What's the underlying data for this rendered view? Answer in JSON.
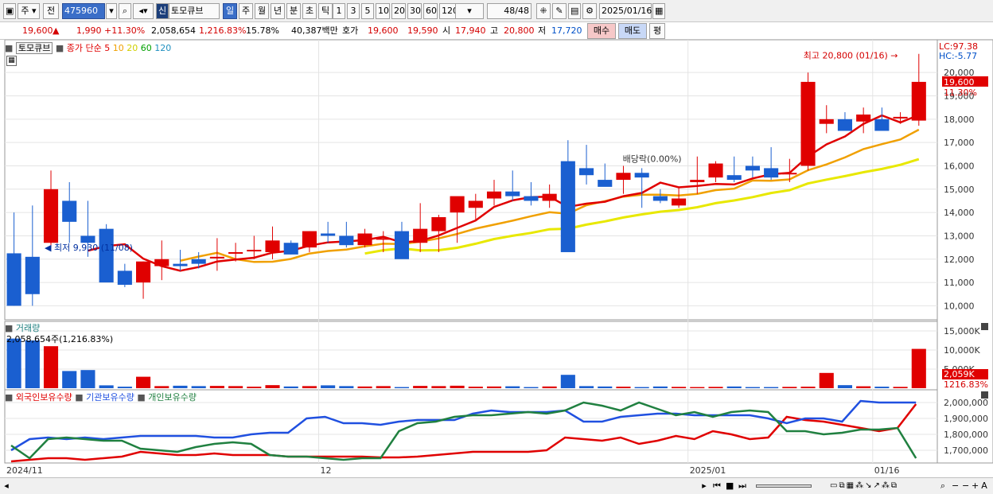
{
  "toolbar": {
    "market": "주",
    "all": "전",
    "code": "475960",
    "credit_badge": "신",
    "stock_name": "토모큐브",
    "periods": [
      "일",
      "주",
      "월",
      "년",
      "분",
      "초",
      "틱"
    ],
    "selected_period": "일",
    "intervals": [
      "1",
      "3",
      "5",
      "10",
      "20",
      "30",
      "60",
      "120"
    ],
    "count": "48",
    "count_total": "/48",
    "date": "2025/01/16"
  },
  "quote": {
    "price": "19,600",
    "arrow": "▲",
    "change": "1,990",
    "change_pct": "+11.30%",
    "volume": "2,058,654",
    "volume_pct": "1,216.83%",
    "turnover": "15.78%",
    "amount": "40,387백만",
    "bid_label": "호가",
    "ask": "19,600",
    "bid": "19,590",
    "open_label": "시",
    "open": "17,940",
    "high_label": "고",
    "high": "20,800",
    "low_label": "저",
    "low": "17,720",
    "buy_btn": "매수",
    "sell_btn": "매도",
    "eval_btn": "평"
  },
  "price_panel": {
    "name_tag": "토모큐브",
    "ma_label": "종가 단순",
    "ma_periods": [
      "5",
      "10",
      "20",
      "60",
      "120"
    ],
    "ma_colors": [
      "#e00000",
      "#f0a000",
      "#e8e800",
      "#00a000",
      "#2090c0"
    ],
    "lc": "LC:97.38",
    "hc": "HC:-5.77",
    "high_annot": "최고 20,800 (01/16)",
    "low_annot": "최저 9,930 (11/08)",
    "dividend_annot": "배당락(0.00%)",
    "last_price_tag": "19,600",
    "last_pct_tag": "11.30%"
  },
  "volume_panel": {
    "title": "거래량",
    "value_label": "2,058,654주(1,216.83%)",
    "last_tag": "2,059K",
    "last_pct_tag": "1216.83%"
  },
  "holding_panel": {
    "series_names": [
      "외국인보유수량",
      "기관보유수량",
      "개인보유수량"
    ],
    "series_colors": [
      "#e00000",
      "#2050e0",
      "#208040"
    ]
  },
  "x_axis": {
    "labels": [
      {
        "text": "2024/11",
        "index": 0
      },
      {
        "text": "12",
        "index": 17
      },
      {
        "text": "2025/01",
        "index": 37
      },
      {
        "text": "01/16",
        "index": 47
      }
    ]
  },
  "chart_data": [
    {
      "type": "candlestick",
      "x": [
        "11/05",
        "11/06",
        "11/07",
        "11/08",
        "11/11",
        "11/12",
        "11/13",
        "11/14",
        "11/15",
        "11/18",
        "11/19",
        "11/20",
        "11/21",
        "11/22",
        "11/25",
        "11/26",
        "11/27",
        "11/28",
        "11/29",
        "12/02",
        "12/03",
        "12/04",
        "12/05",
        "12/06",
        "12/09",
        "12/10",
        "12/11",
        "12/12",
        "12/13",
        "12/16",
        "12/17",
        "12/18",
        "12/19",
        "12/20",
        "12/23",
        "12/24",
        "12/26",
        "12/27",
        "12/30",
        "01/02",
        "01/03",
        "01/06",
        "01/07",
        "01/08",
        "01/09",
        "01/10",
        "01/13",
        "01/14",
        "01/15",
        "01/16"
      ],
      "open": [
        12250,
        12100,
        12700,
        14500,
        13000,
        13300,
        11500,
        11000,
        11700,
        11800,
        12000,
        12100,
        12300,
        12400,
        12300,
        12700,
        12500,
        13100,
        13000,
        12600,
        12900,
        13200,
        12700,
        13200,
        14000,
        14200,
        14600,
        14900,
        14700,
        14500,
        16200,
        15900,
        15400,
        15400,
        15700,
        14700,
        14300,
        15300,
        15500,
        15600,
        16000,
        15900,
        15700,
        16000,
        17800,
        18000,
        17900,
        18000,
        18100,
        17940
      ],
      "high": [
        14000,
        14300,
        15800,
        15300,
        14500,
        13500,
        11800,
        11900,
        12800,
        12400,
        12300,
        12900,
        12700,
        13000,
        13400,
        12800,
        13200,
        13600,
        13600,
        13300,
        13200,
        13600,
        14400,
        13900,
        14600,
        14800,
        15400,
        15800,
        15300,
        15200,
        17100,
        16900,
        16100,
        16000,
        15900,
        15000,
        15100,
        16400,
        16200,
        16400,
        16400,
        16800,
        16300,
        20000,
        18600,
        18300,
        18500,
        18500,
        18300,
        20800
      ],
      "low": [
        10000,
        10000,
        12500,
        12700,
        12100,
        11400,
        10800,
        10300,
        11100,
        11500,
        11600,
        11500,
        11900,
        12000,
        12000,
        12200,
        12300,
        12700,
        12500,
        12500,
        12300,
        12500,
        12300,
        12300,
        12700,
        13700,
        14300,
        14500,
        14300,
        14200,
        14000,
        15200,
        15200,
        14800,
        14200,
        14400,
        14200,
        14800,
        15300,
        15300,
        15500,
        15400,
        15300,
        15800,
        17400,
        17700,
        17400,
        17600,
        17800,
        17720
      ],
      "close": [
        10000,
        10500,
        15000,
        13600,
        12700,
        11000,
        10900,
        11900,
        12000,
        11700,
        11800,
        12100,
        12300,
        12400,
        12800,
        12200,
        13200,
        13000,
        12600,
        13100,
        12900,
        12000,
        13300,
        13800,
        14700,
        14500,
        14900,
        14700,
        14500,
        14800,
        12300,
        15600,
        15100,
        15700,
        15500,
        14500,
        14600,
        15400,
        16100,
        15400,
        15800,
        15500,
        15700,
        19600,
        18000,
        17500,
        18200,
        17500,
        18100,
        19600
      ],
      "dividend_index": 34
    },
    {
      "type": "bar",
      "name": "거래량",
      "values": [
        2600,
        2500,
        2200,
        900,
        950,
        150,
        80,
        600,
        110,
        130,
        110,
        120,
        110,
        80,
        160,
        90,
        110,
        150,
        110,
        90,
        110,
        60,
        120,
        110,
        130,
        80,
        90,
        100,
        60,
        90,
        700,
        110,
        90,
        80,
        60,
        90,
        70,
        60,
        70,
        90,
        60,
        60,
        70,
        80,
        800,
        160,
        100,
        80,
        70,
        2059
      ],
      "unit": "K"
    },
    {
      "type": "line",
      "name": "보유수량",
      "series": [
        {
          "name": "외국인보유수량",
          "values": [
            1630,
            1640,
            1650,
            1650,
            1640,
            1650,
            1660,
            1690,
            1680,
            1670,
            1670,
            1680,
            1670,
            1670,
            1670,
            1660,
            1660,
            1660,
            1660,
            1660,
            1655,
            1655,
            1660,
            1670,
            1680,
            1690,
            1690,
            1690,
            1690,
            1700,
            1780,
            1770,
            1760,
            1780,
            1740,
            1760,
            1790,
            1770,
            1820,
            1800,
            1770,
            1780,
            1910,
            1890,
            1880,
            1860,
            1840,
            1820,
            1840,
            1990
          ]
        },
        {
          "name": "기관보유수량",
          "values": [
            1700,
            1770,
            1780,
            1770,
            1780,
            1770,
            1780,
            1790,
            1790,
            1790,
            1790,
            1780,
            1780,
            1800,
            1810,
            1810,
            1900,
            1910,
            1870,
            1870,
            1860,
            1880,
            1890,
            1890,
            1890,
            1930,
            1950,
            1940,
            1940,
            1940,
            1950,
            1880,
            1880,
            1910,
            1920,
            1930,
            1930,
            1920,
            1920,
            1920,
            1920,
            1900,
            1870,
            1900,
            1900,
            1880,
            2010,
            2000,
            2000,
            2000
          ]
        },
        {
          "name": "개인보유수량",
          "values": [
            1730,
            1650,
            1770,
            1780,
            1770,
            1760,
            1760,
            1710,
            1700,
            1690,
            1720,
            1740,
            1750,
            1740,
            1670,
            1660,
            1660,
            1650,
            1640,
            1650,
            1650,
            1820,
            1870,
            1880,
            1910,
            1920,
            1920,
            1930,
            1940,
            1930,
            1950,
            2000,
            1980,
            1950,
            2000,
            1960,
            1920,
            1940,
            1910,
            1940,
            1950,
            1940,
            1820,
            1820,
            1800,
            1810,
            1830,
            1830,
            1840,
            1650
          ]
        }
      ]
    }
  ],
  "y_axes": {
    "price": [
      "20,000",
      "19,000",
      "18,000",
      "17,000",
      "16,000",
      "15,000",
      "14,000",
      "13,000",
      "12,000",
      "11,000",
      "10,000"
    ],
    "volume": [
      "15,000K",
      "10,000K",
      "5,000K"
    ],
    "holding": [
      "2,000,000",
      "1,900,000",
      "1,800,000",
      "1,700,000"
    ]
  }
}
